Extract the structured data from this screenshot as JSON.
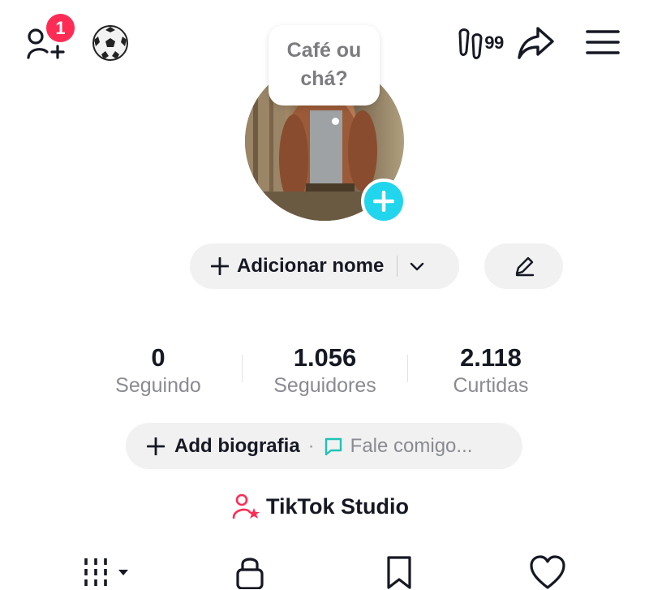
{
  "top_bar": {
    "notification_count": "1",
    "views_count": "99"
  },
  "profile": {
    "note_bubble": "Café ou chá?",
    "add_name_label": "Adicionar nome"
  },
  "stats": [
    {
      "value": "0",
      "label": "Seguindo"
    },
    {
      "value": "1.056",
      "label": "Seguidores"
    },
    {
      "value": "2.118",
      "label": "Curtidas"
    }
  ],
  "bio": {
    "add_label": "Add biografia",
    "separator": "·",
    "hint": "Fale comigo..."
  },
  "studio": {
    "label": "TikTok Studio"
  },
  "colors": {
    "badge": "#fe2c55",
    "avatar_add": "#20d5ec",
    "chat_icon": "#20c3b4",
    "studio_icon": "#fe2c55",
    "muted_text": "#8a8b91"
  },
  "icons": [
    "add-friend-icon",
    "soccer-ball-icon",
    "footprint-icon",
    "share-icon",
    "menu-icon",
    "plus-icon",
    "chevron-down-icon",
    "pencil-icon",
    "chat-icon",
    "studio-user-star-icon",
    "grid-icon",
    "lock-icon",
    "bookmark-icon",
    "heart-icon"
  ]
}
